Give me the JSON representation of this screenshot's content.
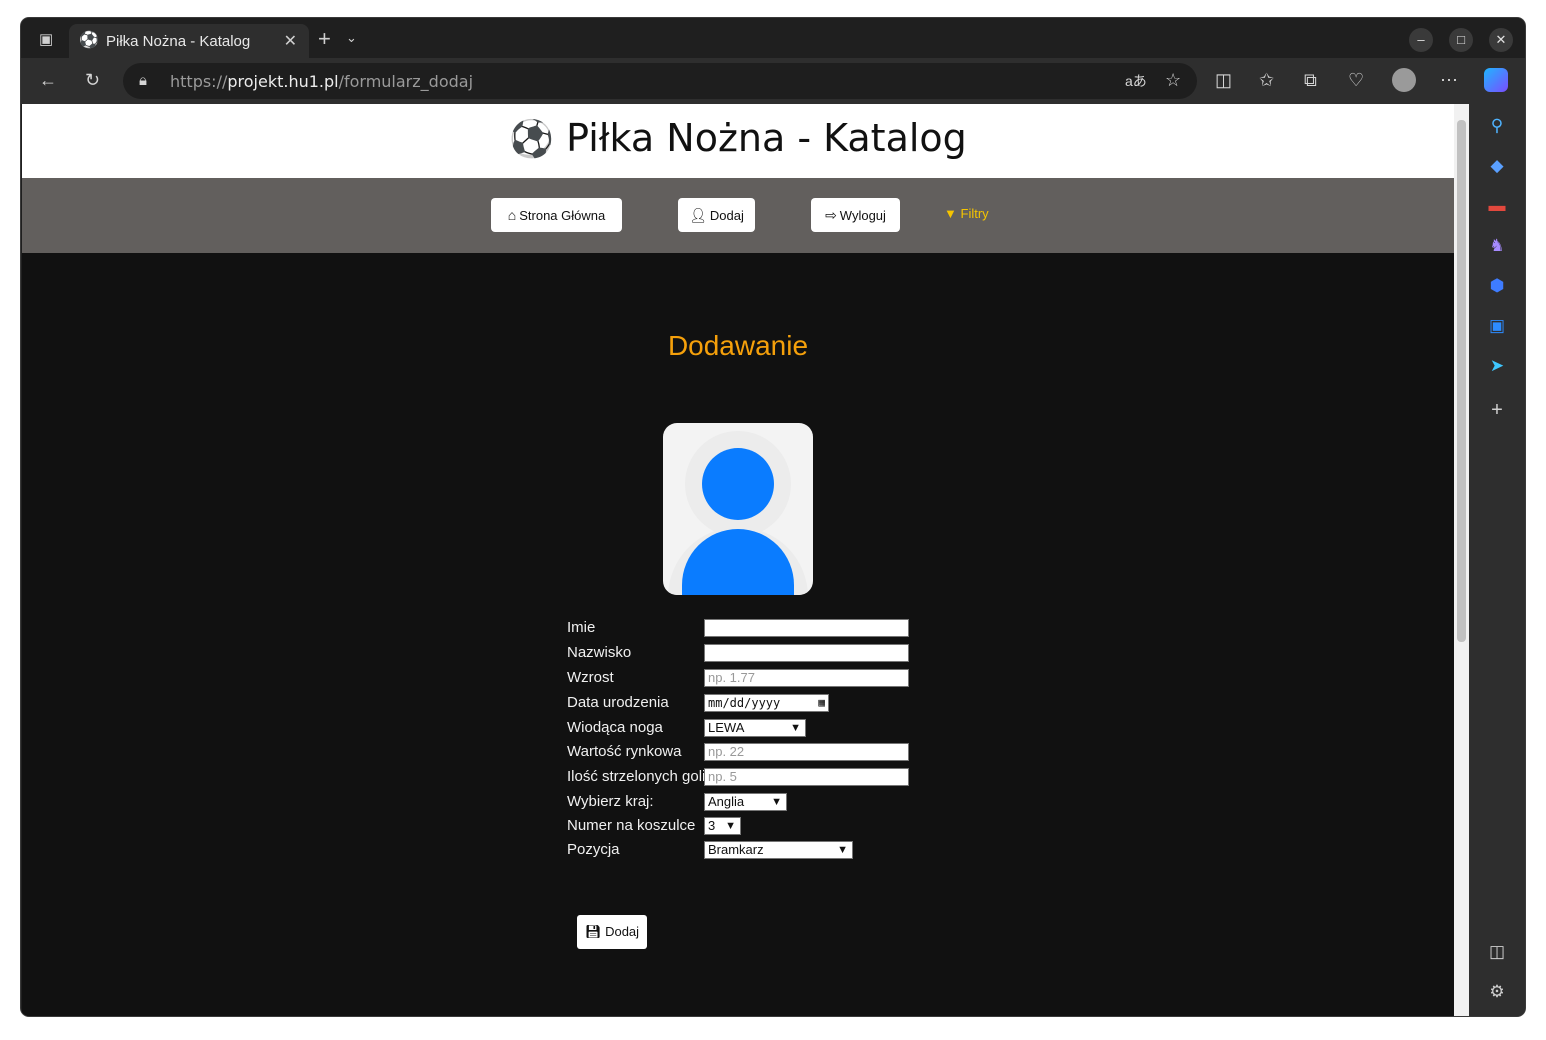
{
  "browser": {
    "tab_title": "Piłka Nożna - Katalog",
    "tab_favicon": "⚽",
    "url_scheme": "https://",
    "url_host": "projekt.hu1.pl",
    "url_path": "/formularz_dodaj"
  },
  "page": {
    "site_title": "Piłka Nożna - Katalog",
    "site_icon": "⚽",
    "nav": {
      "home": "Strona Główna",
      "add": "Dodaj",
      "logout": "Wyloguj",
      "filters": "Filtry"
    },
    "heading": "Dodawanie",
    "form": {
      "imie_label": "Imie",
      "imie_value": "",
      "nazwisko_label": "Nazwisko",
      "nazwisko_value": "",
      "wzrost_label": "Wzrost",
      "wzrost_placeholder": "np. 1.77",
      "data_label": "Data urodzenia",
      "data_placeholder": "mm/dd/yyyy",
      "noga_label": "Wiodąca noga",
      "noga_value": "LEWA",
      "wartosc_label": "Wartość rynkowa",
      "wartosc_placeholder": "np. 22",
      "gole_label": "Ilość strzelonych goli",
      "gole_placeholder": "np. 5",
      "kraj_label": "Wybierz kraj:",
      "kraj_value": "Anglia",
      "numer_label": "Numer na koszulce",
      "numer_value": "3",
      "pozycja_label": "Pozycja",
      "pozycja_value": "Bramkarz",
      "submit_label": "Dodaj"
    }
  },
  "colors": {
    "nav_bg": "#625f5d",
    "page_bg": "#111111",
    "heading": "#f5a00b",
    "filters": "#f5c400",
    "avatar": "#0a7cff"
  }
}
